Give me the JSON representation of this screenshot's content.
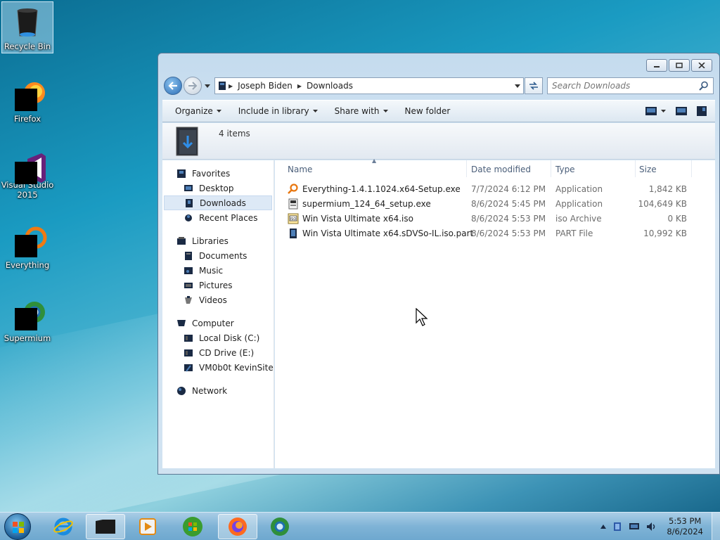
{
  "desktop": {
    "icons": [
      {
        "label": "Recycle Bin",
        "icon": "recycle-bin-icon"
      },
      {
        "label": "Firefox",
        "icon": "firefox-icon"
      },
      {
        "label": "Visual Studio 2015",
        "icon": "visual-studio-icon"
      },
      {
        "label": "Everything",
        "icon": "everything-icon"
      },
      {
        "label": "Supermium",
        "icon": "supermium-icon"
      }
    ]
  },
  "window": {
    "address": {
      "crumbs": [
        "Joseph Biden",
        "Downloads"
      ]
    },
    "search": {
      "placeholder": "Search Downloads"
    },
    "toolbar": {
      "organize": "Organize",
      "include_in_library": "Include in library",
      "share_with": "Share with",
      "new_folder": "New folder"
    },
    "details": {
      "item_count": "4 items"
    },
    "nav_pane": {
      "favorites": {
        "label": "Favorites",
        "items": [
          "Desktop",
          "Downloads",
          "Recent Places"
        ]
      },
      "libraries": {
        "label": "Libraries",
        "items": [
          "Documents",
          "Music",
          "Pictures",
          "Videos"
        ]
      },
      "computer": {
        "label": "Computer",
        "items": [
          "Local Disk (C:)",
          "CD Drive (E:)",
          "VM0b0t KevinSite"
        ]
      },
      "network": {
        "label": "Network"
      }
    },
    "columns": {
      "name": "Name",
      "date_modified": "Date modified",
      "type": "Type",
      "size": "Size"
    },
    "files": [
      {
        "name": "Everything-1.4.1.1024.x64-Setup.exe",
        "date": "7/7/2024 6:12 PM",
        "type": "Application",
        "size": "1,842 KB",
        "icon": "everything-setup-icon"
      },
      {
        "name": "supermium_124_64_setup.exe",
        "date": "8/6/2024 5:45 PM",
        "type": "Application",
        "size": "104,649 KB",
        "icon": "installer-icon"
      },
      {
        "name": "Win Vista Ultimate x64.iso",
        "date": "8/6/2024 5:53 PM",
        "type": "iso Archive",
        "size": "0 KB",
        "icon": "iso-icon"
      },
      {
        "name": "Win Vista Ultimate x64.sDVSo-IL.iso.part",
        "date": "8/6/2024 5:53 PM",
        "type": "PART File",
        "size": "10,992 KB",
        "icon": "part-file-icon"
      }
    ]
  },
  "taskbar": {
    "clock_time": "5:53 PM",
    "clock_date": "8/6/2024"
  },
  "colors": {
    "accent": "#2a6bb5",
    "selection": "#dde9f6"
  }
}
